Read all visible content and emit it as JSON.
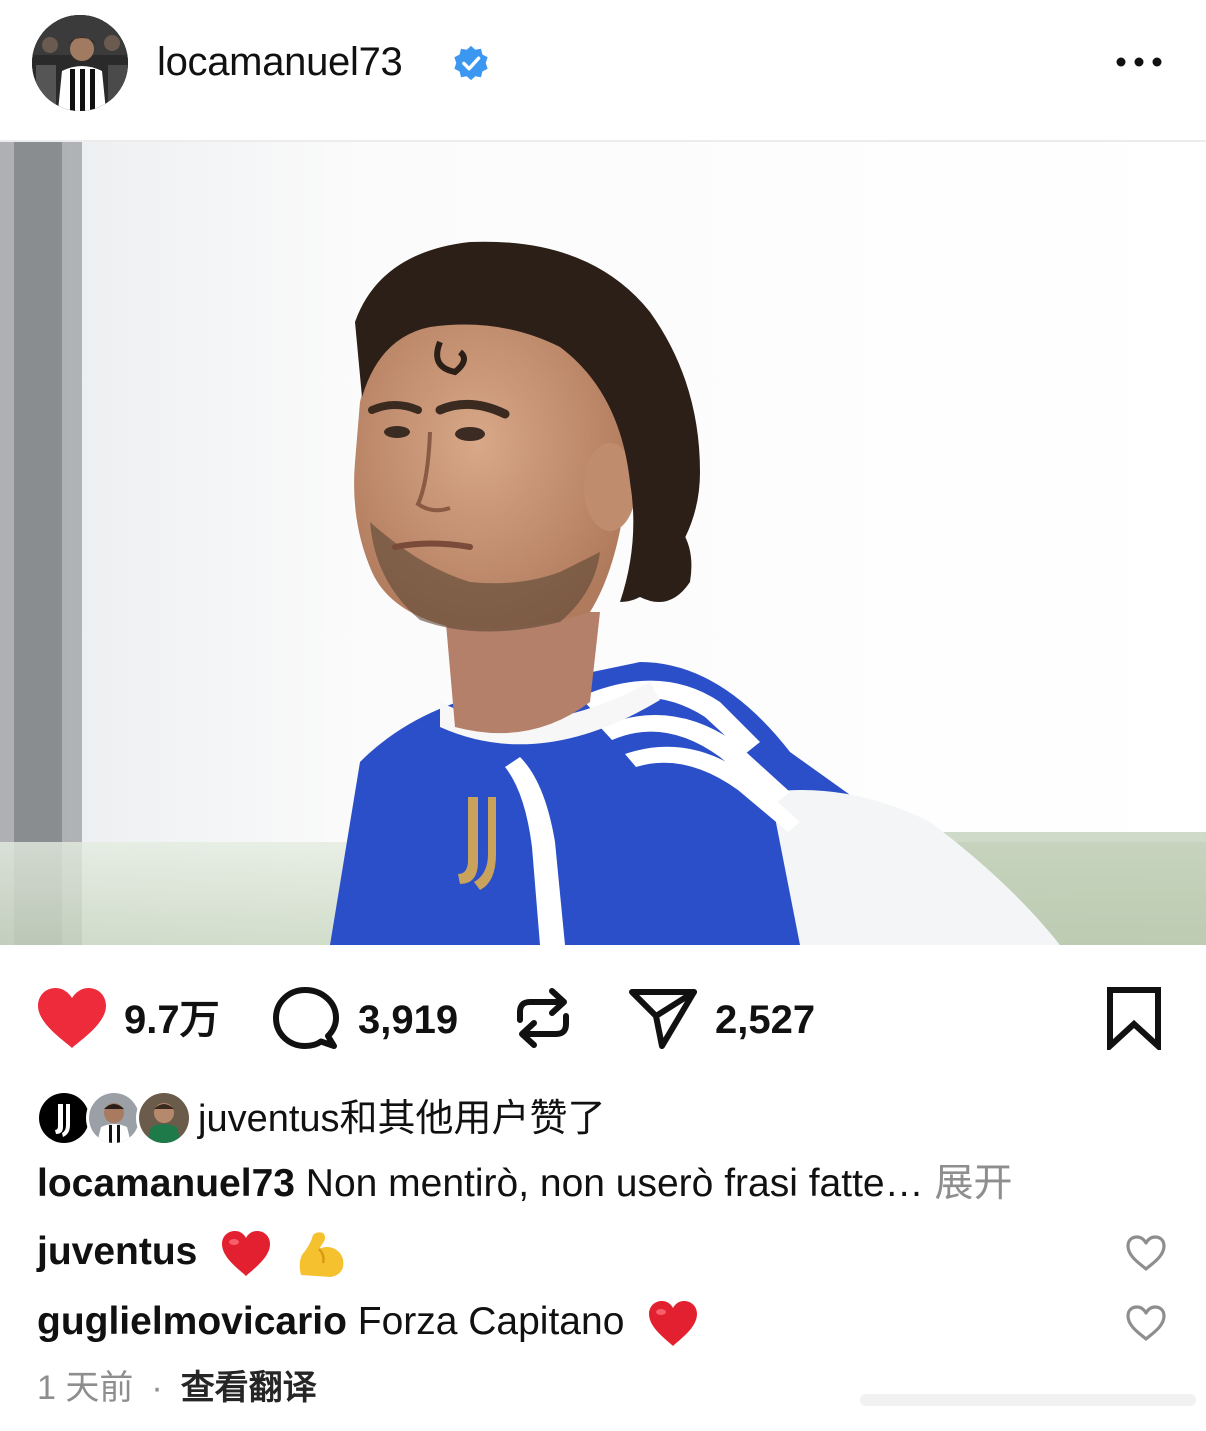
{
  "header": {
    "username": "locamanuel73",
    "verified_icon": "verified-badge-icon",
    "more_icon": "more-horizontal-icon"
  },
  "photo": {
    "description_icon": "post-photo"
  },
  "actions": {
    "likes_count": "9.7万",
    "comments_count": "3,919",
    "shares_count": "2,527",
    "icons": [
      "heart-filled-icon",
      "comment-icon",
      "repost-icon",
      "send-icon",
      "bookmark-icon"
    ],
    "like_color": "#ed2b3b"
  },
  "liked_by": {
    "text": "juventus和其他用户赞了"
  },
  "caption": {
    "username": "locamanuel73",
    "text": " Non mentirò, non userò frasi fatte…",
    "more": " 展开"
  },
  "comments": [
    {
      "username": "juventus",
      "text": ""
    },
    {
      "username": "guglielmovicario",
      "text": " Forza Capitano"
    }
  ],
  "footer": {
    "time": "1 天前",
    "separator": "·",
    "translate": "查看翻译"
  }
}
